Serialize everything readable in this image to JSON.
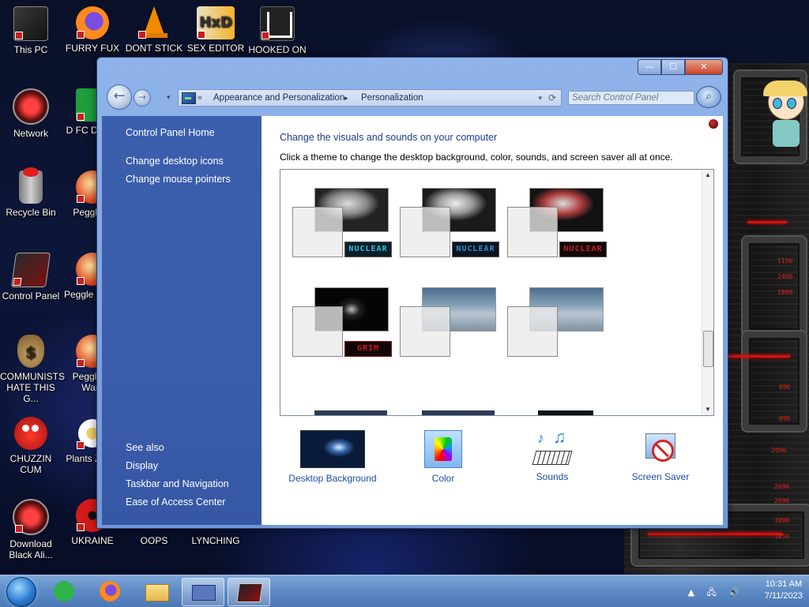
{
  "desktop": {
    "icons": [
      {
        "label": "This PC"
      },
      {
        "label": "FURRY FUX"
      },
      {
        "label": "DONT STICK"
      },
      {
        "label": "SEX EDITOR"
      },
      {
        "label": "HOOKED ON"
      },
      {
        "label": "Network"
      },
      {
        "label": "D FC DUMB"
      },
      {
        "label": "Recycle Bin"
      },
      {
        "label": "Peggle D"
      },
      {
        "label": "Control Panel"
      },
      {
        "label": "Peggle I Delu"
      },
      {
        "label": "COMMUNISTS HATE THIS G..."
      },
      {
        "label": "Peggle of Warc"
      },
      {
        "label": "CHUZZIN CUM"
      },
      {
        "label": "Plants Zomb"
      },
      {
        "label": "Download Black Ali..."
      },
      {
        "label": "UKRAINE"
      },
      {
        "label": "OOPS"
      },
      {
        "label": "LYNCHING"
      }
    ],
    "gadget_values": [
      "1156",
      "2496",
      "1896",
      "096",
      "096",
      "2096",
      "2696",
      "2696",
      "3896",
      "1856"
    ]
  },
  "window": {
    "caption": {
      "minimize": "—",
      "maximize": "☐",
      "close": "✕"
    },
    "nav": {
      "back_icon": "back-arrow-icon",
      "forward_icon": "forward-arrow-icon"
    },
    "address": {
      "chevron": "«",
      "crumbs": [
        "Appearance and Personalization",
        "Personalization"
      ],
      "separator": "▸"
    },
    "search": {
      "placeholder": "Search Control Panel"
    },
    "sidebar": {
      "links_top": [
        "Control Panel Home",
        "Change desktop icons",
        "Change mouse pointers"
      ],
      "see_also_title": "See also",
      "links_bottom": [
        "Display",
        "Taskbar and Navigation",
        "Ease of Access Center"
      ]
    },
    "content": {
      "heading": "Change the visuals and sounds on your computer",
      "subheading": "Click a theme to change the desktop background, color, sounds, and screen saver all at once.",
      "themes": [
        {
          "logo": "NUCLEAR",
          "logo_color": "#27c3d9",
          "style": "nuke"
        },
        {
          "logo": "NUCLEAR",
          "logo_color": "#2a8fd6",
          "style": "nuke2"
        },
        {
          "logo": "NUCLEAR",
          "logo_color": "#c81c1c",
          "style": "nuke3"
        },
        {
          "logo": "GRIM",
          "logo_color": "#d01a1a",
          "style": "grim"
        },
        {
          "logo": "",
          "logo_color": "",
          "style": "ship"
        },
        {
          "logo": "",
          "logo_color": "",
          "style": "ship"
        }
      ],
      "tools": [
        {
          "label": "Desktop Background",
          "icon": "desktop-background-icon"
        },
        {
          "label": "Color",
          "icon": "color-palette-icon"
        },
        {
          "label": "Sounds",
          "icon": "sounds-icon"
        },
        {
          "label": "Screen Saver",
          "icon": "screen-saver-icon"
        }
      ]
    }
  },
  "taskbar": {
    "time": "10:31 AM",
    "date": "7/11/2023",
    "tray_icons": [
      "▲",
      "network-icon",
      "volume-icon"
    ]
  },
  "colors": {
    "link_blue": "#1b4ea8",
    "heading_blue": "#1b3c8a",
    "sidebar_bg": "#3a5cab"
  }
}
